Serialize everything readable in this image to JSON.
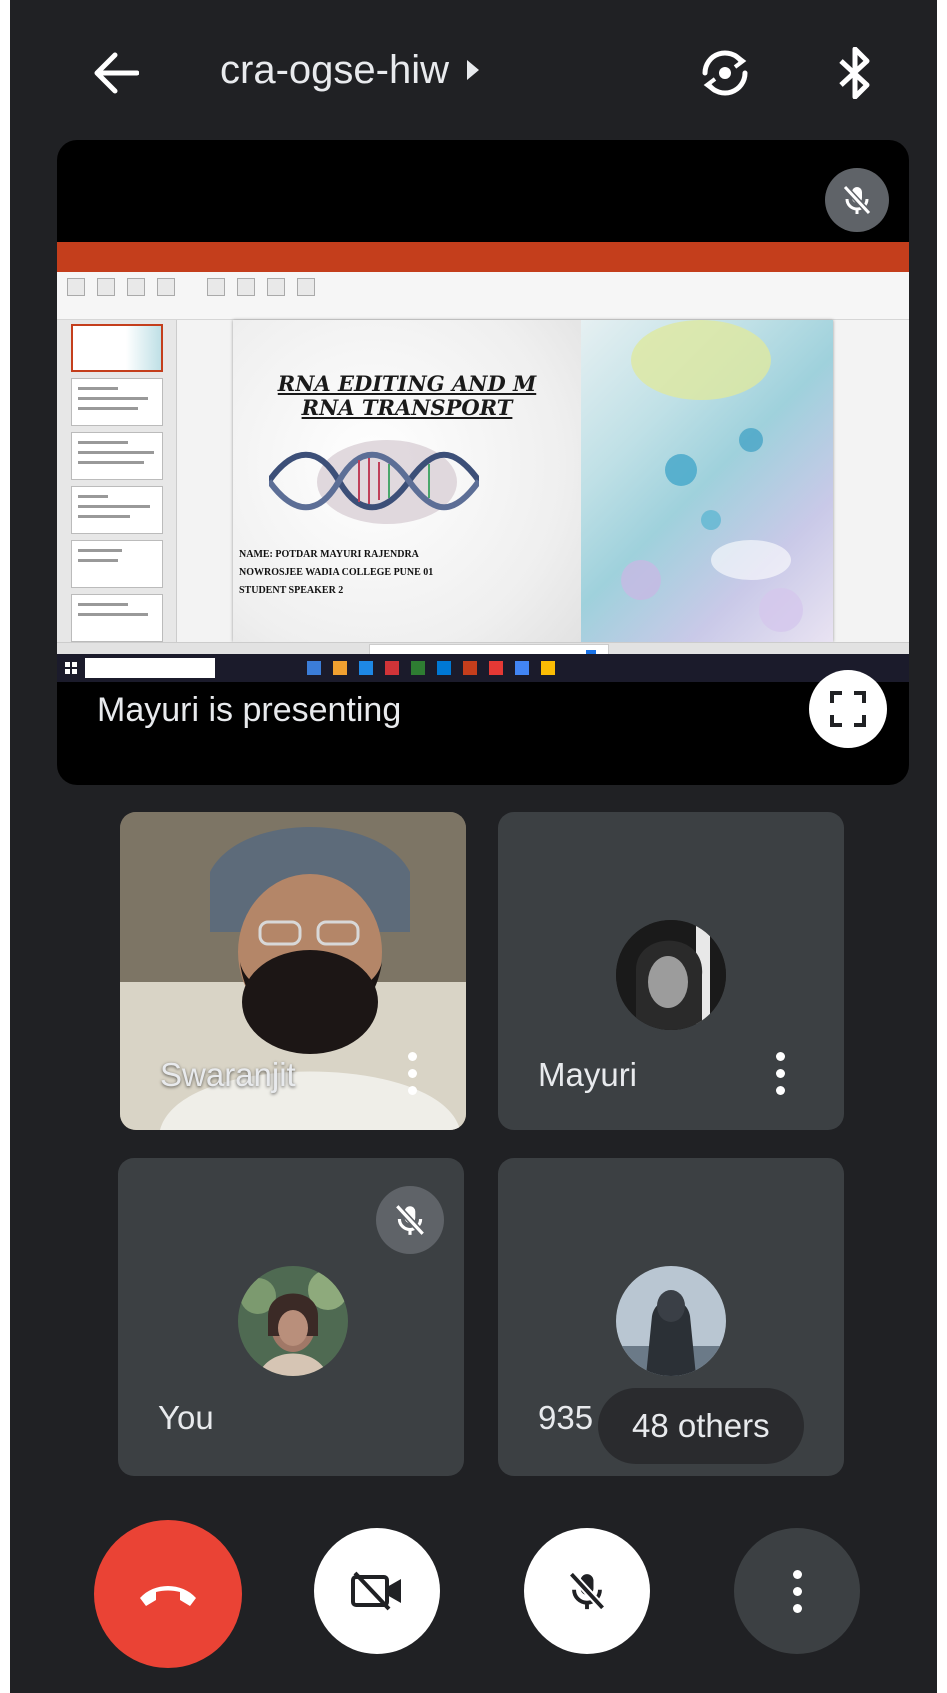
{
  "header": {
    "meeting_code": "cra-ogse-hiw",
    "icons": {
      "back": "arrow-left-icon",
      "switch_camera": "switch-camera-icon",
      "bluetooth": "bluetooth-icon"
    }
  },
  "presentation": {
    "presenting_label": "Mayuri is presenting",
    "slide": {
      "title_line1": "RNA EDITING AND M",
      "title_line2": "RNA TRANSPORT",
      "info_line1": "NAME: POTDAR MAYURI RAJENDRA",
      "info_line2": "NOWROSJEE WADIA COLLEGE PUNE 01",
      "info_line3": "STUDENT  SPEAKER 2"
    }
  },
  "participants": [
    {
      "name": "Swaranjit",
      "video_on": true,
      "muted": false
    },
    {
      "name": "Mayuri",
      "video_on": false,
      "muted": false
    },
    {
      "name": "You",
      "video_on": false,
      "muted": true
    },
    {
      "name": "935",
      "others_label": "48 others"
    }
  ],
  "controls": {
    "end_call": "end-call-icon",
    "camera": "camera-off-icon",
    "mic": "mic-off-icon",
    "more": "more-vert-icon"
  },
  "colors": {
    "background": "#202124",
    "tile": "#3c4043",
    "end_call": "#ea4335",
    "text": "#e8eaed"
  }
}
